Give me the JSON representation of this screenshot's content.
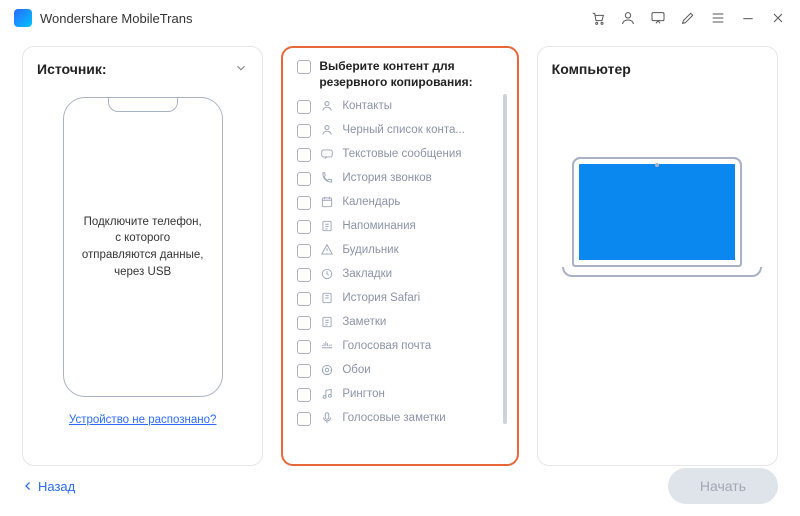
{
  "app": {
    "title": "Wondershare MobileTrans"
  },
  "source": {
    "title": "Источник:",
    "phone_msg": "Подключите телефон, с которого отправляются данные, через USB",
    "not_recognized": "Устройство не распознано?"
  },
  "center": {
    "header": "Выберите контент для резервного копирования:",
    "items": [
      {
        "label": "Контакты",
        "icon": "contact"
      },
      {
        "label": "Черный список конта...",
        "icon": "contact"
      },
      {
        "label": "Текстовые сообщения",
        "icon": "message"
      },
      {
        "label": "История звонков",
        "icon": "phone"
      },
      {
        "label": "Календарь",
        "icon": "calendar"
      },
      {
        "label": "Напоминания",
        "icon": "reminder"
      },
      {
        "label": "Будильник",
        "icon": "alarm"
      },
      {
        "label": "Закладки",
        "icon": "bookmark"
      },
      {
        "label": "История Safari",
        "icon": "history"
      },
      {
        "label": "Заметки",
        "icon": "note"
      },
      {
        "label": "Голосовая почта",
        "icon": "voicemail"
      },
      {
        "label": "Обои",
        "icon": "wallpaper"
      },
      {
        "label": "Рингтон",
        "icon": "ringtone"
      },
      {
        "label": "Голосовые заметки",
        "icon": "mic"
      }
    ]
  },
  "dest": {
    "title": "Компьютер"
  },
  "footer": {
    "back": "Назад",
    "start": "Начать"
  }
}
